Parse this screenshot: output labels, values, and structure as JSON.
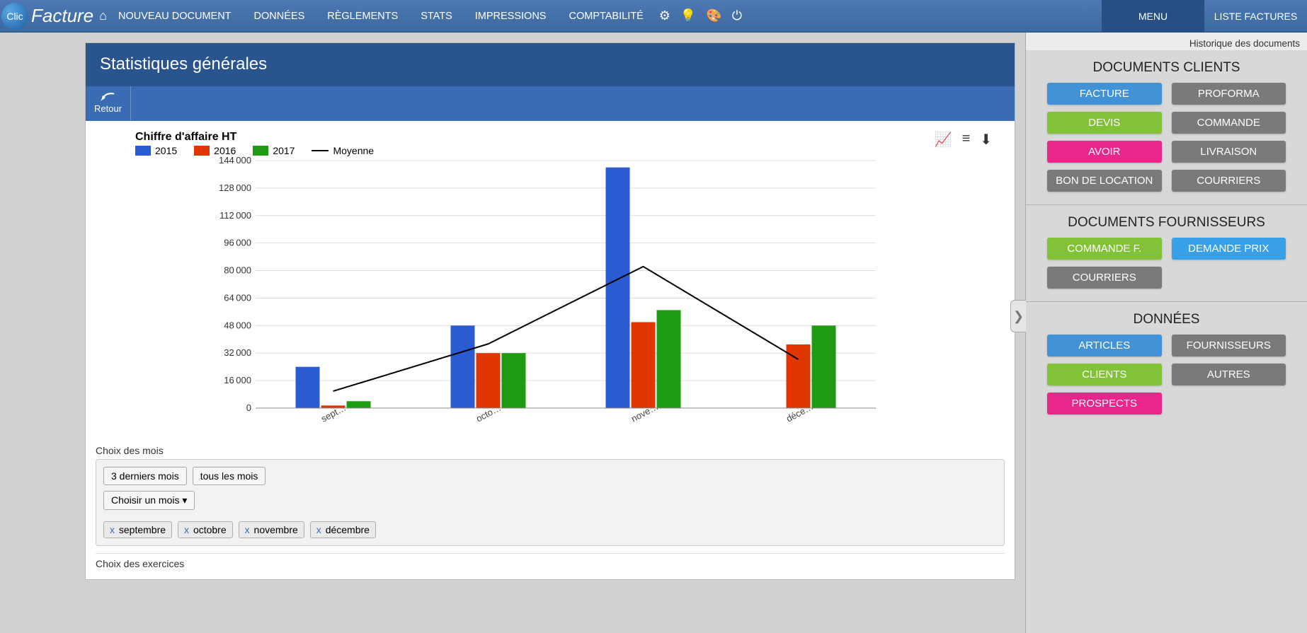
{
  "logo": {
    "circle": "Clic",
    "text": "Facture"
  },
  "nav": {
    "items": [
      "NOUVEAU DOCUMENT",
      "DONNÉES",
      "RÈGLEMENTS",
      "STATS",
      "IMPRESSIONS",
      "COMPTABILITÉ"
    ]
  },
  "top_tabs": {
    "menu": "MENU",
    "liste": "LISTE FACTURES"
  },
  "page": {
    "title": "Statistiques générales"
  },
  "toolbar": {
    "back": "Retour"
  },
  "chart_data": {
    "type": "bar",
    "title": "Chiffre d'affaire HT",
    "categories": [
      "sept…",
      "octo…",
      "nove…",
      "déce…"
    ],
    "series": [
      {
        "name": "2015",
        "color": "#2a5bd1",
        "values": [
          24000,
          48000,
          140000,
          0
        ]
      },
      {
        "name": "2016",
        "color": "#e23600",
        "values": [
          1500,
          32000,
          50000,
          37000
        ]
      },
      {
        "name": "2017",
        "color": "#1f9b12",
        "values": [
          4000,
          32000,
          57000,
          48000
        ]
      }
    ],
    "moyenne": {
      "name": "Moyenne",
      "values": [
        9833,
        37333,
        82333,
        28333
      ]
    },
    "y_ticks": [
      0,
      16000,
      32000,
      48000,
      64000,
      80000,
      96000,
      112000,
      128000,
      144000
    ],
    "ylim": [
      0,
      144000
    ]
  },
  "controls": {
    "choix_mois_label": "Choix des mois",
    "choix_exercices_label": "Choix des exercices",
    "btn_3_derniers": "3 derniers mois",
    "btn_tous": "tous les mois",
    "dropdown": "Choisir un mois",
    "chips": [
      "septembre",
      "octobre",
      "novembre",
      "décembre"
    ],
    "chip_x": "x"
  },
  "sidebar": {
    "history": "Historique des documents",
    "sections": {
      "clients": {
        "title": "DOCUMENTS CLIENTS",
        "buttons": [
          {
            "label": "FACTURE",
            "cls": "c-blue"
          },
          {
            "label": "PROFORMA",
            "cls": "c-gray"
          },
          {
            "label": "DEVIS",
            "cls": "c-green"
          },
          {
            "label": "COMMANDE",
            "cls": "c-gray"
          },
          {
            "label": "AVOIR",
            "cls": "c-pink"
          },
          {
            "label": "LIVRAISON",
            "cls": "c-gray"
          },
          {
            "label": "BON DE LOCATION",
            "cls": "c-gray"
          },
          {
            "label": "COURRIERS",
            "cls": "c-gray"
          }
        ]
      },
      "fournisseurs": {
        "title": "DOCUMENTS FOURNISSEURS",
        "buttons": [
          {
            "label": "COMMANDE F.",
            "cls": "c-green"
          },
          {
            "label": "DEMANDE PRIX",
            "cls": "c-blue2"
          },
          {
            "label": "COURRIERS",
            "cls": "c-gray"
          }
        ]
      },
      "donnees": {
        "title": "DONNÉES",
        "buttons": [
          {
            "label": "ARTICLES",
            "cls": "c-blue"
          },
          {
            "label": "FOURNISSEURS",
            "cls": "c-gray"
          },
          {
            "label": "CLIENTS",
            "cls": "c-green"
          },
          {
            "label": "AUTRES",
            "cls": "c-gray"
          },
          {
            "label": "PROSPECTS",
            "cls": "c-pink"
          }
        ]
      }
    }
  }
}
